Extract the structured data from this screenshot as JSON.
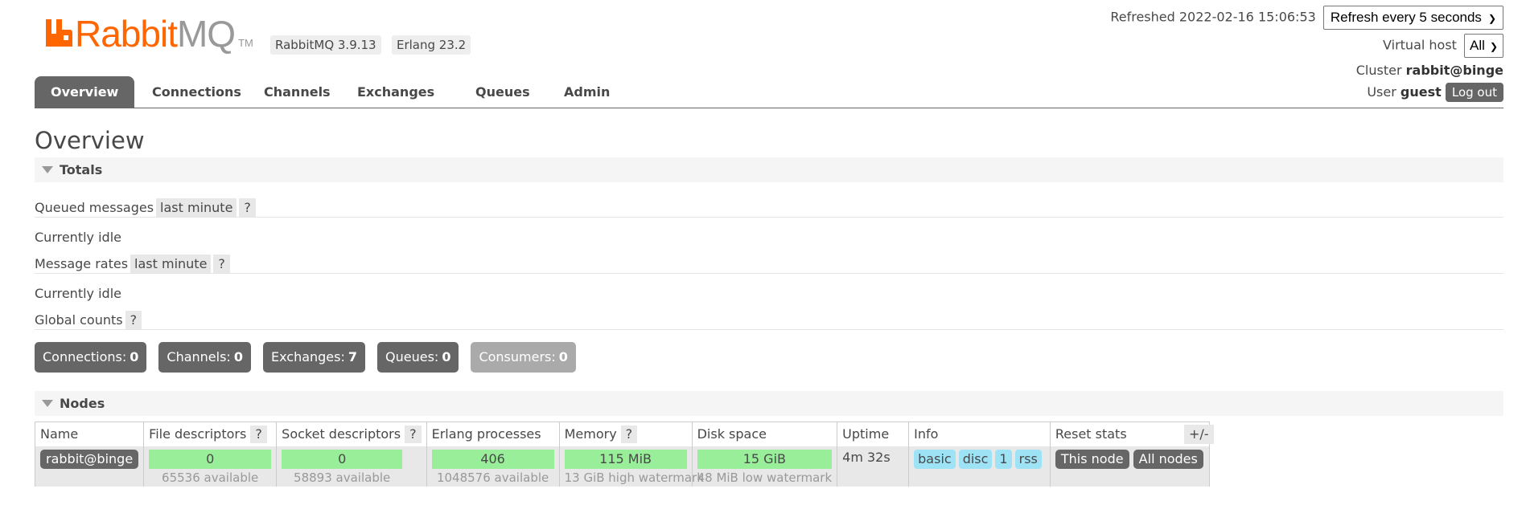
{
  "header": {
    "logo_rabbit": "Rabbit",
    "logo_mq": "MQ",
    "logo_tm": "TM",
    "version_badge": "RabbitMQ 3.9.13",
    "erlang_badge": "Erlang 23.2"
  },
  "status": {
    "refreshed_label": "Refreshed 2022-02-16 15:06:53",
    "refresh_select": "Refresh every 5 seconds",
    "vhost_label": "Virtual host",
    "vhost_select": "All",
    "cluster_label": "Cluster",
    "cluster_name": "rabbit@binge",
    "user_label": "User",
    "user_name": "guest",
    "logout_label": "Log out"
  },
  "tabs": [
    "Overview",
    "Connections",
    "Channels",
    "Exchanges",
    "Queues",
    "Admin"
  ],
  "page_title": "Overview",
  "totals": {
    "heading": "Totals",
    "queued_label": "Queued messages",
    "queued_period": "last minute",
    "help": "?",
    "queued_status": "Currently idle",
    "rates_label": "Message rates",
    "rates_period": "last minute",
    "rates_status": "Currently idle",
    "global_label": "Global counts"
  },
  "counts": [
    {
      "label": "Connections:",
      "value": "0"
    },
    {
      "label": "Channels:",
      "value": "0"
    },
    {
      "label": "Exchanges:",
      "value": "7"
    },
    {
      "label": "Queues:",
      "value": "0"
    },
    {
      "label": "Consumers:",
      "value": "0"
    }
  ],
  "nodes": {
    "heading": "Nodes",
    "columns": {
      "name": "Name",
      "fd": "File descriptors",
      "sd": "Socket descriptors",
      "erl": "Erlang processes",
      "mem": "Memory",
      "disk": "Disk space",
      "uptime": "Uptime",
      "info": "Info",
      "reset": "Reset stats"
    },
    "plus_minus": "+/-",
    "row": {
      "name": "rabbit@binge",
      "fd_value": "0",
      "fd_sub": "65536 available",
      "sd_value": "0",
      "sd_sub": "58893 available",
      "erl_value": "406",
      "erl_sub": "1048576 available",
      "mem_value": "115 MiB",
      "mem_sub": "13 GiB high watermark",
      "disk_value": "15 GiB",
      "disk_sub": "48 MiB low watermark",
      "uptime": "4m 32s",
      "info_tags": [
        "basic",
        "disc",
        "1",
        "rss"
      ],
      "reset_this": "This node",
      "reset_all": "All nodes"
    }
  },
  "colors": {
    "brand_orange": "#ff6600",
    "tab_active": "#666666",
    "bar_green": "#99ee99",
    "info_cyan": "#9ee3f5"
  }
}
